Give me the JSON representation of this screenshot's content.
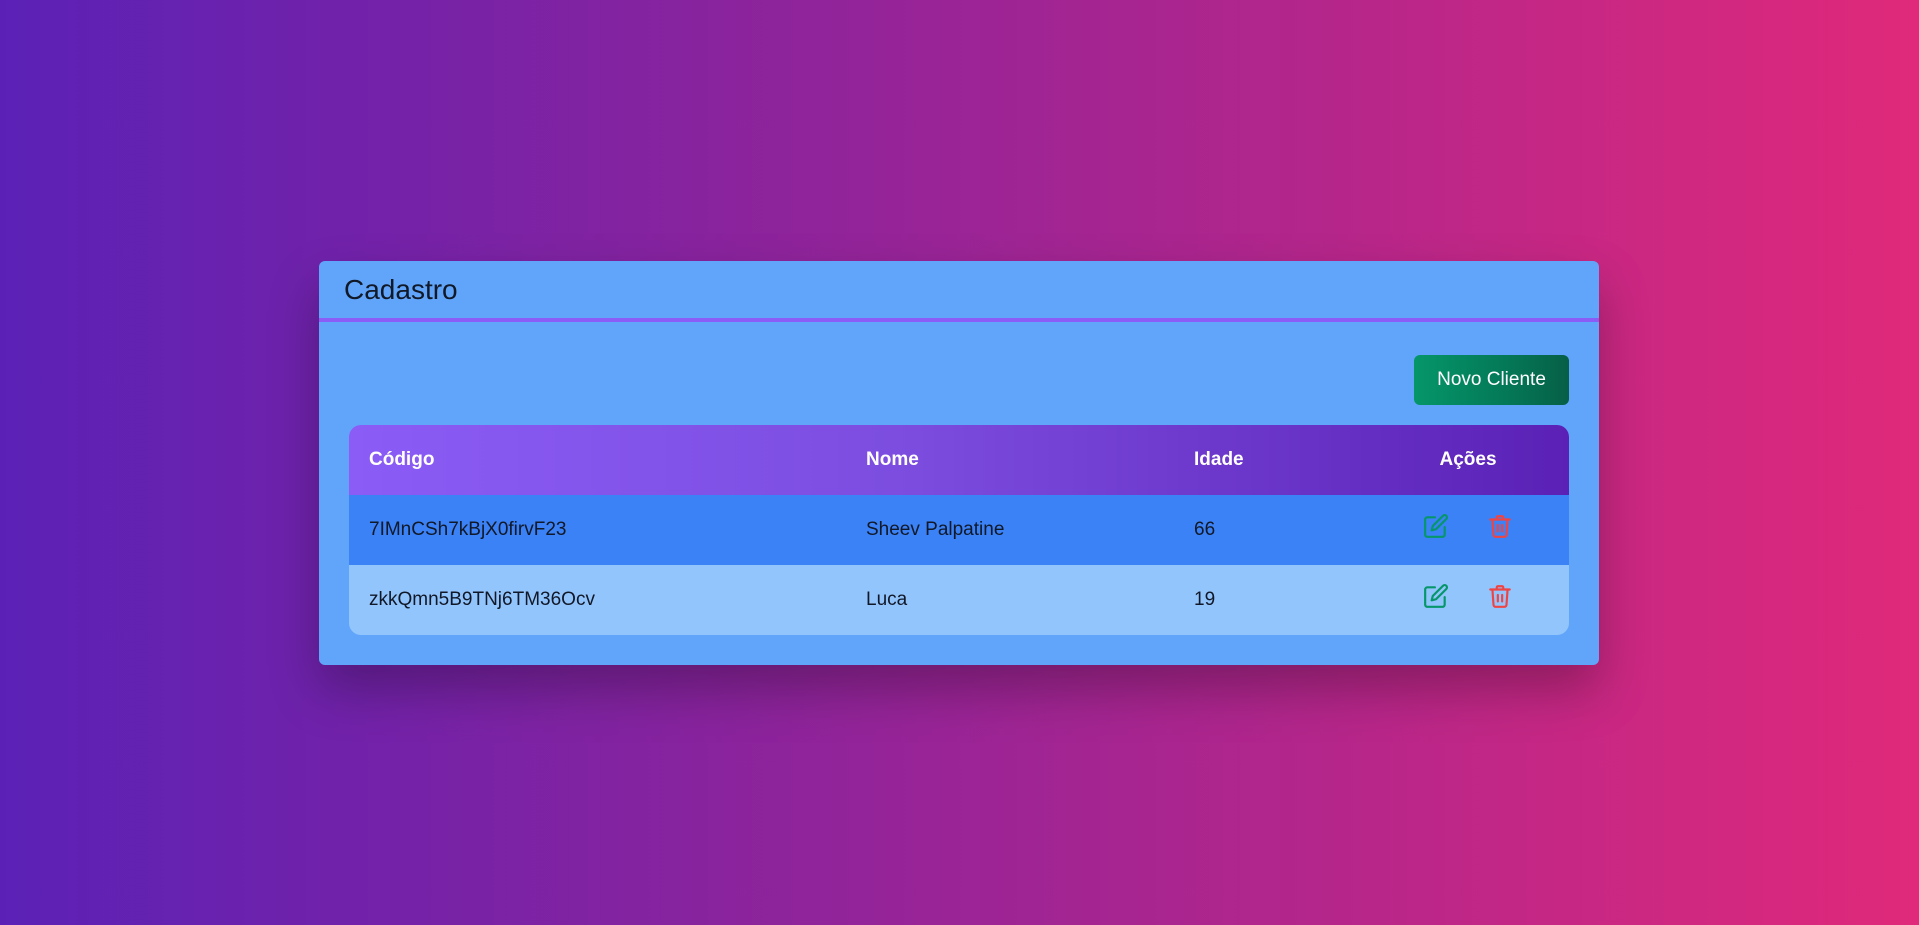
{
  "card": {
    "title": "Cadastro"
  },
  "toolbar": {
    "new_client_label": "Novo Cliente"
  },
  "table": {
    "headers": {
      "code": "Código",
      "name": "Nome",
      "age": "Idade",
      "actions": "Ações"
    },
    "rows": [
      {
        "code": "7IMnCSh7kBjX0firvF23",
        "name": "Sheev Palpatine",
        "age": "66"
      },
      {
        "code": "zkkQmn5B9TNj6TM36Ocv",
        "name": "Luca",
        "age": "19"
      }
    ]
  },
  "icons": {
    "edit": "edit-icon",
    "delete": "trash-icon"
  },
  "colors": {
    "edit_icon": "#059669",
    "delete_icon": "#ef4444",
    "card_bg": "#60a5fa",
    "header_accent": "#8b5cf6"
  }
}
